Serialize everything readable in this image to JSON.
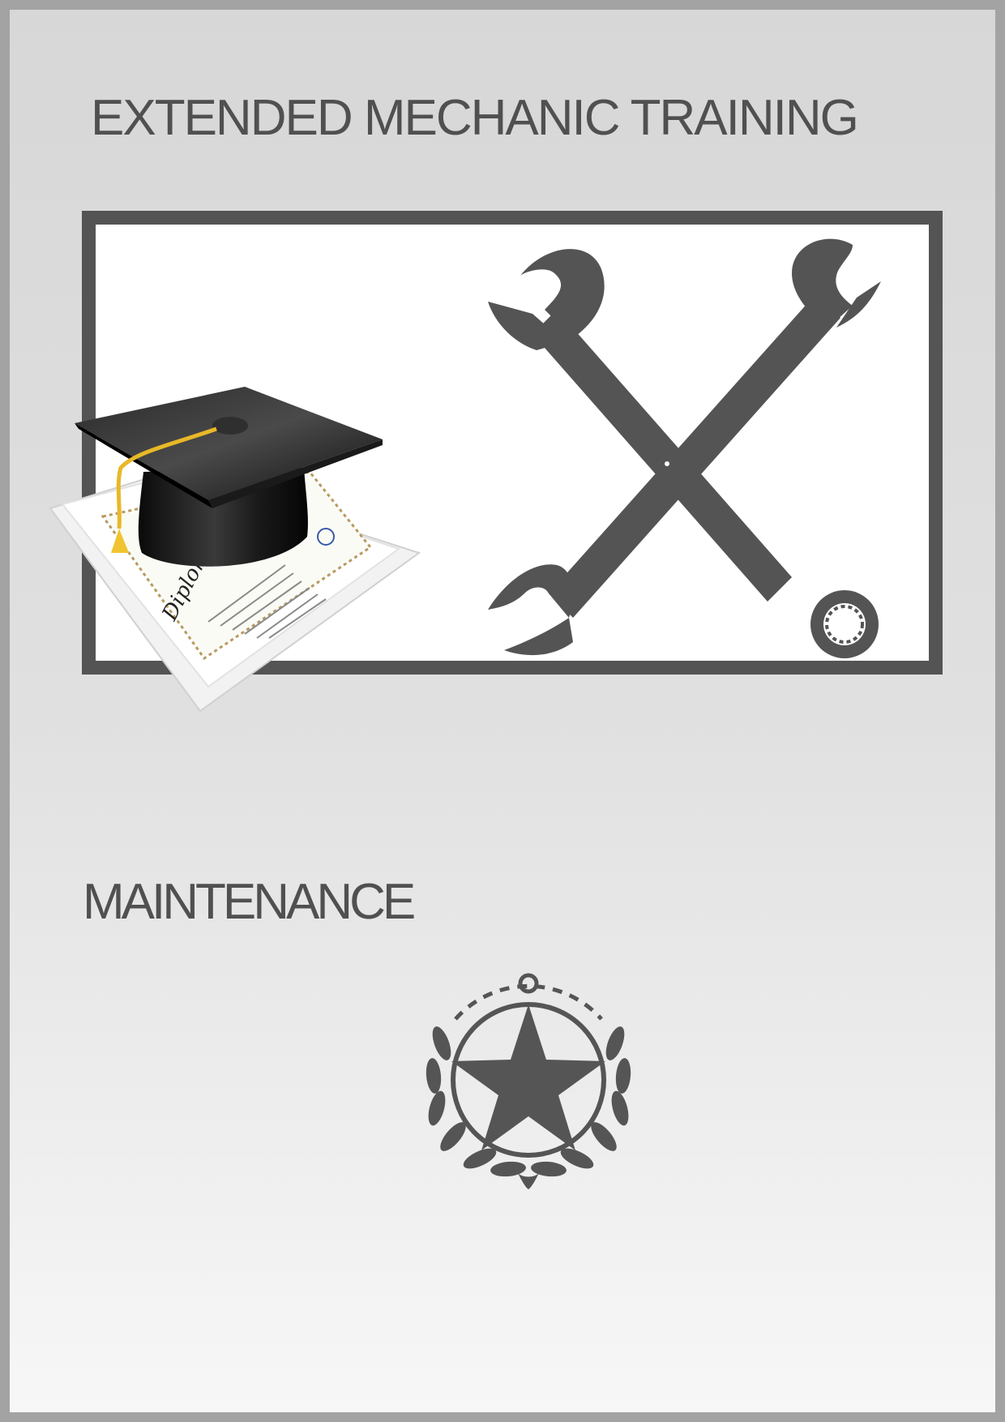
{
  "header": {
    "title": "EXTENDED MECHANIC TRAINING"
  },
  "section": {
    "label": "MAINTENANCE"
  },
  "illustration": {
    "diploma_text": "Diploma",
    "icons": [
      "graduation-cap-icon",
      "diploma-icon",
      "crossed-wrenches-icon",
      "star-emblem-icon"
    ]
  },
  "colors": {
    "border": "#a3a3a3",
    "text": "#505050",
    "icon_gray": "#545454",
    "tassel": "#f0c430",
    "seal_blue": "#3a5aa8"
  }
}
